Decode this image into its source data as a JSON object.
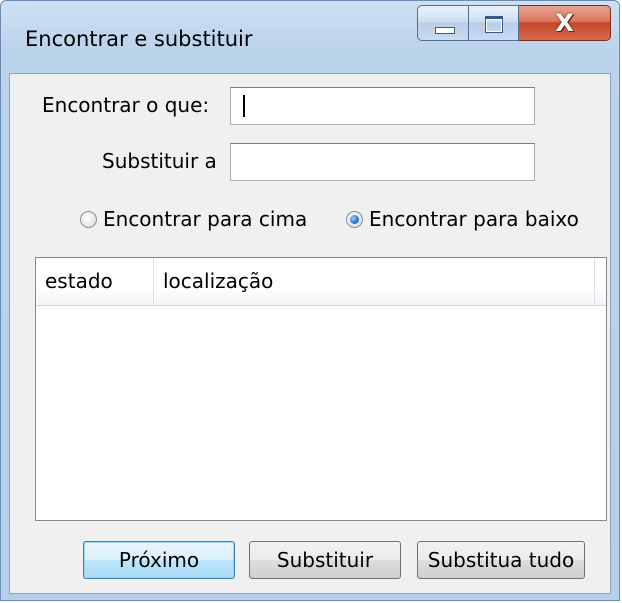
{
  "window": {
    "title": "Encontrar e substituir",
    "close_glyph": "X"
  },
  "form": {
    "find_label": "Encontrar o que:",
    "find_value": "",
    "replace_label": "Substituir a",
    "replace_value": ""
  },
  "direction": {
    "up_label": "Encontrar para cima",
    "down_label": "Encontrar para baixo",
    "selected": "down"
  },
  "results": {
    "columns": [
      "estado",
      "localização"
    ],
    "rows": []
  },
  "buttons": {
    "next": "Próximo",
    "replace": "Substituir",
    "replace_all": "Substitua tudo"
  },
  "icons": {
    "minimize": "minimize-icon",
    "maximize": "maximize-icon",
    "close": "close-icon"
  },
  "colors": {
    "titlebar": "#bcd3ec",
    "close_button": "#c4472b",
    "client_background": "#f0f0f0",
    "default_button": "#bee6fd"
  }
}
